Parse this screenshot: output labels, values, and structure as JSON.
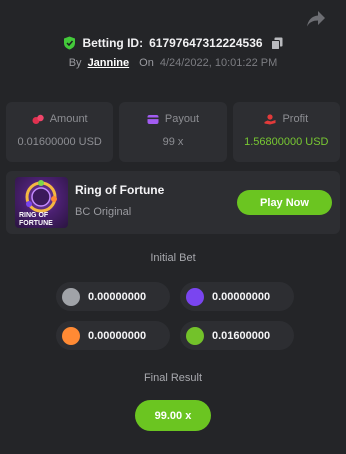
{
  "header": {
    "betting_id_label": "Betting ID:",
    "betting_id": "61797647312224536",
    "by_label": "By",
    "username": "Jannine",
    "on_label": "On",
    "datetime": "4/24/2022, 10:01:22 PM"
  },
  "stats": {
    "amount": {
      "label": "Amount",
      "value": "0.01600000 USD",
      "icon": "coins-icon"
    },
    "payout": {
      "label": "Payout",
      "value": "99 x",
      "icon": "wallet-icon"
    },
    "profit": {
      "label": "Profit",
      "value": "1.56800000 USD",
      "icon": "hand-coins-icon"
    }
  },
  "game": {
    "title": "Ring of Fortune",
    "subtitle": "BC Original",
    "play_label": "Play Now",
    "thumb_text_top": "RING OF",
    "thumb_text_bottom": "FORTUNE"
  },
  "initial_bet": {
    "label": "Initial Bet",
    "bets": [
      {
        "color": "#a0a3a8",
        "amount": "0.00000000"
      },
      {
        "color": "#7a45f0",
        "amount": "0.00000000"
      },
      {
        "color": "#ff8a34",
        "amount": "0.00000000"
      },
      {
        "color": "#73c22a",
        "amount": "0.01600000"
      }
    ]
  },
  "final_result": {
    "label": "Final Result",
    "value": "99.00 x"
  },
  "colors": {
    "background": "#242528",
    "card": "#2d2e32",
    "accent_green": "#6bc521",
    "profit_green": "#78c832"
  }
}
